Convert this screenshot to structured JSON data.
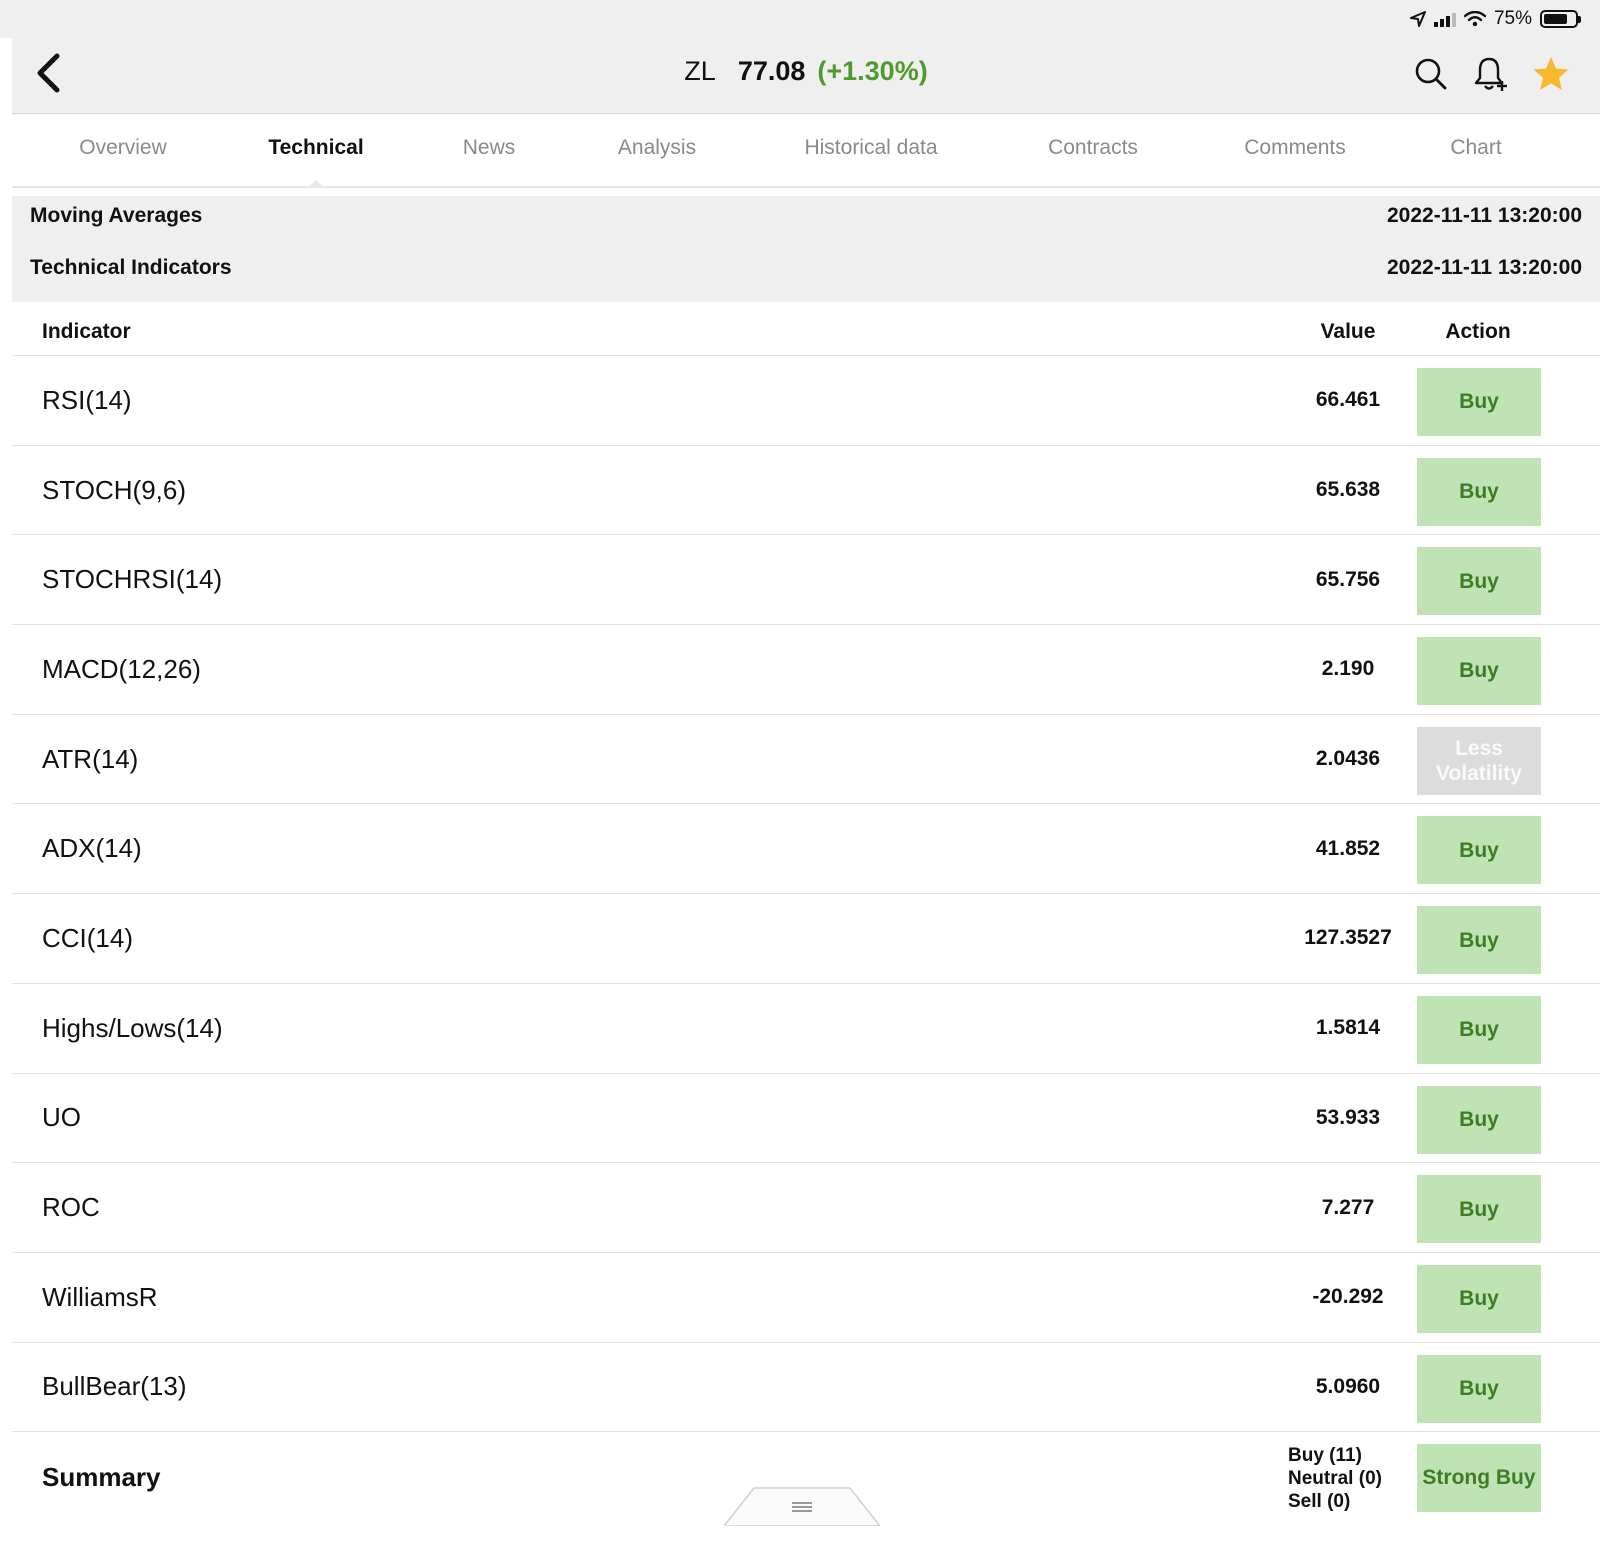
{
  "status_bar": {
    "battery": "75%"
  },
  "header": {
    "symbol": "ZL",
    "price": "77.08",
    "change": "(+1.30%)",
    "colors": {
      "positive": "#4e9a2c",
      "star": "#f5b82e"
    },
    "icons": [
      "chevron-left-icon",
      "search-icon",
      "bell-plus-icon",
      "star-icon"
    ]
  },
  "tabs": [
    {
      "label": "Overview"
    },
    {
      "label": "Technical",
      "active": true
    },
    {
      "label": "News"
    },
    {
      "label": "Analysis"
    },
    {
      "label": "Historical data"
    },
    {
      "label": "Contracts"
    },
    {
      "label": "Comments"
    },
    {
      "label": "Chart"
    }
  ],
  "sections": {
    "moving_averages": {
      "label": "Moving Averages",
      "time": "2022-11-11 13:20:00"
    },
    "technical_indicators": {
      "label": "Technical Indicators",
      "time": "2022-11-11 13:20:00"
    }
  },
  "table": {
    "headers": {
      "indicator": "Indicator",
      "value": "Value",
      "action": "Action"
    },
    "rows": [
      {
        "name": "RSI(14)",
        "value": "66.461",
        "action": "Buy"
      },
      {
        "name": "STOCH(9,6)",
        "value": "65.638",
        "action": "Buy"
      },
      {
        "name": "STOCHRSI(14)",
        "value": "65.756",
        "action": "Buy"
      },
      {
        "name": "MACD(12,26)",
        "value": "2.190",
        "action": "Buy"
      },
      {
        "name": "ATR(14)",
        "value": "2.0436",
        "action": "Less Volatility"
      },
      {
        "name": "ADX(14)",
        "value": "41.852",
        "action": "Buy"
      },
      {
        "name": "CCI(14)",
        "value": "127.3527",
        "action": "Buy"
      },
      {
        "name": "Highs/Lows(14)",
        "value": "1.5814",
        "action": "Buy"
      },
      {
        "name": "UO",
        "value": "53.933",
        "action": "Buy"
      },
      {
        "name": "ROC",
        "value": "7.277",
        "action": "Buy"
      },
      {
        "name": "WilliamsR",
        "value": "-20.292",
        "action": "Buy"
      },
      {
        "name": "BullBear(13)",
        "value": "5.0960",
        "action": "Buy"
      }
    ]
  },
  "summary": {
    "label": "Summary",
    "buy": "Buy (11)",
    "neutral": "Neutral (0)",
    "sell": "Sell (0)",
    "action": "Strong Buy"
  }
}
